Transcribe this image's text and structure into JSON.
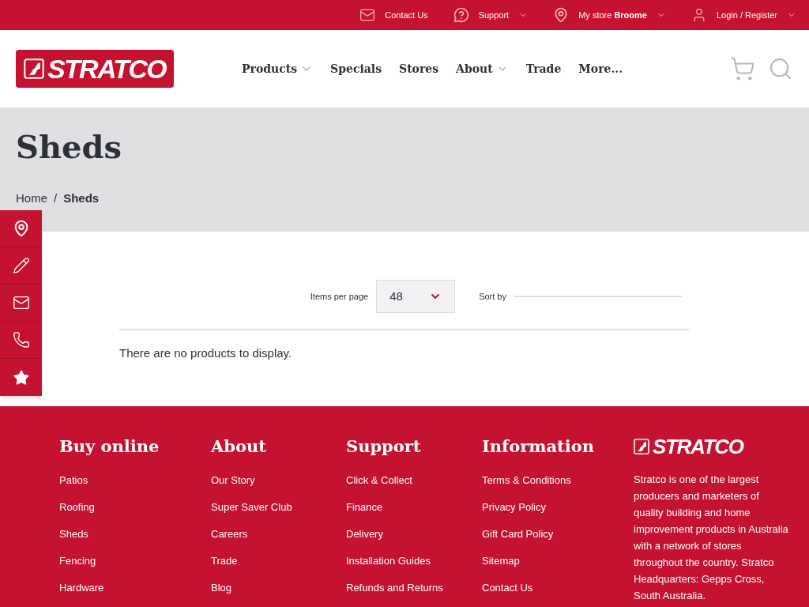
{
  "top_bar": [
    {
      "kind": "mail",
      "label": "Contact Us",
      "has_dropdown": false
    },
    {
      "kind": "help",
      "label": "Support",
      "has_dropdown": true
    },
    {
      "kind": "pin",
      "label": "My store **Broome**",
      "has_dropdown": true
    },
    {
      "kind": "user",
      "label": "Login / Register",
      "has_dropdown": true
    }
  ],
  "logo": {
    "text": "STRATCO"
  },
  "nav": [
    {
      "label": "Products",
      "has_dropdown": true
    },
    {
      "label": "Specials",
      "has_dropdown": false
    },
    {
      "label": "Stores",
      "has_dropdown": false
    },
    {
      "label": "About",
      "has_dropdown": true
    },
    {
      "label": "Trade",
      "has_dropdown": false
    },
    {
      "label": "More...",
      "has_dropdown": false
    }
  ],
  "page_title": "Sheds",
  "breadcrumb": {
    "separator": "/",
    "items": [
      {
        "label": "Home",
        "current": false
      },
      {
        "label": "Sheds",
        "current": true
      }
    ]
  },
  "side_buttons": [
    {
      "kind": "pin"
    },
    {
      "kind": "pencil"
    },
    {
      "kind": "mail"
    },
    {
      "kind": "phone"
    },
    {
      "kind": "star"
    }
  ],
  "toolbar": {
    "items_per_page": {
      "label": "Items per page",
      "value": "48"
    },
    "sort_by": {
      "label": "Sort by"
    }
  },
  "empty_message": "There are no products to display.",
  "footer": {
    "columns": [
      {
        "title": "Buy online",
        "links": [
          "Patios",
          "Roofing",
          "Sheds",
          "Fencing",
          "Hardware"
        ]
      },
      {
        "title": "About",
        "links": [
          "Our Story",
          "Super Saver Club",
          "Careers",
          "Trade",
          "Blog"
        ]
      },
      {
        "title": "Support",
        "links": [
          "Click & Collect",
          "Finance",
          "Delivery",
          "Installation Guides",
          "Refunds and Returns"
        ]
      },
      {
        "title": "Information",
        "links": [
          "Terms & Conditions",
          "Privacy Policy",
          "Gift Card Policy",
          "Sitemap",
          "Contact Us"
        ]
      }
    ],
    "logo": {
      "text": "STRATCO"
    },
    "about": "Stratco is one of the largest producers and marketers of quality building and home improvement products in Australia with a network of stores throughout the country. Stratco Headquarters: Gepps Cross, South Australia."
  }
}
